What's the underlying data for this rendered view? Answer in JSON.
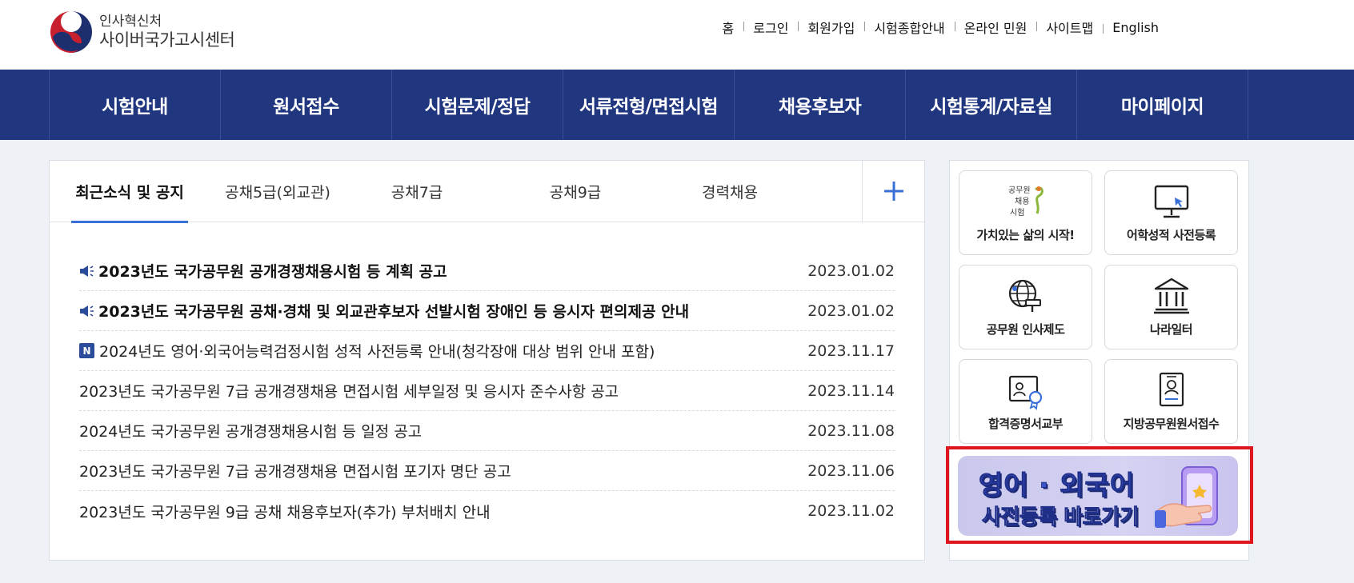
{
  "brand": {
    "org": "인사혁신처",
    "name": "사이버국가고시센터"
  },
  "util_links": [
    "홈",
    "로그인",
    "회원가입",
    "시험종합안내",
    "온라인 민원",
    "사이트맵",
    "English"
  ],
  "gnb": [
    "시험안내",
    "원서접수",
    "시험문제/정답",
    "서류전형/면접시험",
    "채용후보자",
    "시험통계/자료실",
    "마이페이지"
  ],
  "notice": {
    "tabs": [
      "최근소식 및 공지",
      "공채5급(외교관)",
      "공채7급",
      "공채9급",
      "경력채용"
    ],
    "more_icon": "plus-icon",
    "items": [
      {
        "title": "2023년도 국가공무원 공개경쟁채용시험 등 계획 공고",
        "date": "2023.01.02",
        "badge": "speaker"
      },
      {
        "title": "2023년도 국가공무원 공채·경채 및 외교관후보자 선발시험 장애인 등 응시자 편의제공 안내",
        "date": "2023.01.02",
        "badge": "speaker"
      },
      {
        "title": "2024년도 영어·외국어능력검정시험 성적 사전등록 안내(청각장애 대상 범위 안내 포함)",
        "date": "2023.11.17",
        "badge": "N"
      },
      {
        "title": "2023년도 국가공무원 7급 공개경쟁채용 면접시험 세부일정 및 응시자 준수사항 공고",
        "date": "2023.11.14",
        "badge": ""
      },
      {
        "title": "2024년도 국가공무원 공개경쟁채용시험 등 일정 공고",
        "date": "2023.11.08",
        "badge": ""
      },
      {
        "title": "2023년도 국가공무원 7급 공개경쟁채용 면접시험 포기자 명단 공고",
        "date": "2023.11.06",
        "badge": ""
      },
      {
        "title": "2023년도 국가공무원 9급 공채 채용후보자(추가) 부처배치 안내",
        "date": "2023.11.02",
        "badge": ""
      }
    ]
  },
  "quick": [
    {
      "label": "가치있는 삶의 시작!",
      "icon": "recruit-logo-icon",
      "logo_text": "공무원 채용 시험"
    },
    {
      "label": "어학성적 사전등록",
      "icon": "monitor-icon"
    },
    {
      "label": "공무원 인사제도",
      "icon": "globe-gavel-icon"
    },
    {
      "label": "나라일터",
      "icon": "government-building-icon"
    },
    {
      "label": "합격증명서교부",
      "icon": "certificate-icon"
    },
    {
      "label": "지방공무원원서접수",
      "icon": "document-person-icon"
    }
  ],
  "banner": {
    "line1": "영어 · 외국어",
    "line2": "사전등록 바로가기"
  },
  "colors": {
    "gnb_bg": "#20367f",
    "tab_active": "#3a6fd8",
    "highlight": "#e0161e"
  }
}
